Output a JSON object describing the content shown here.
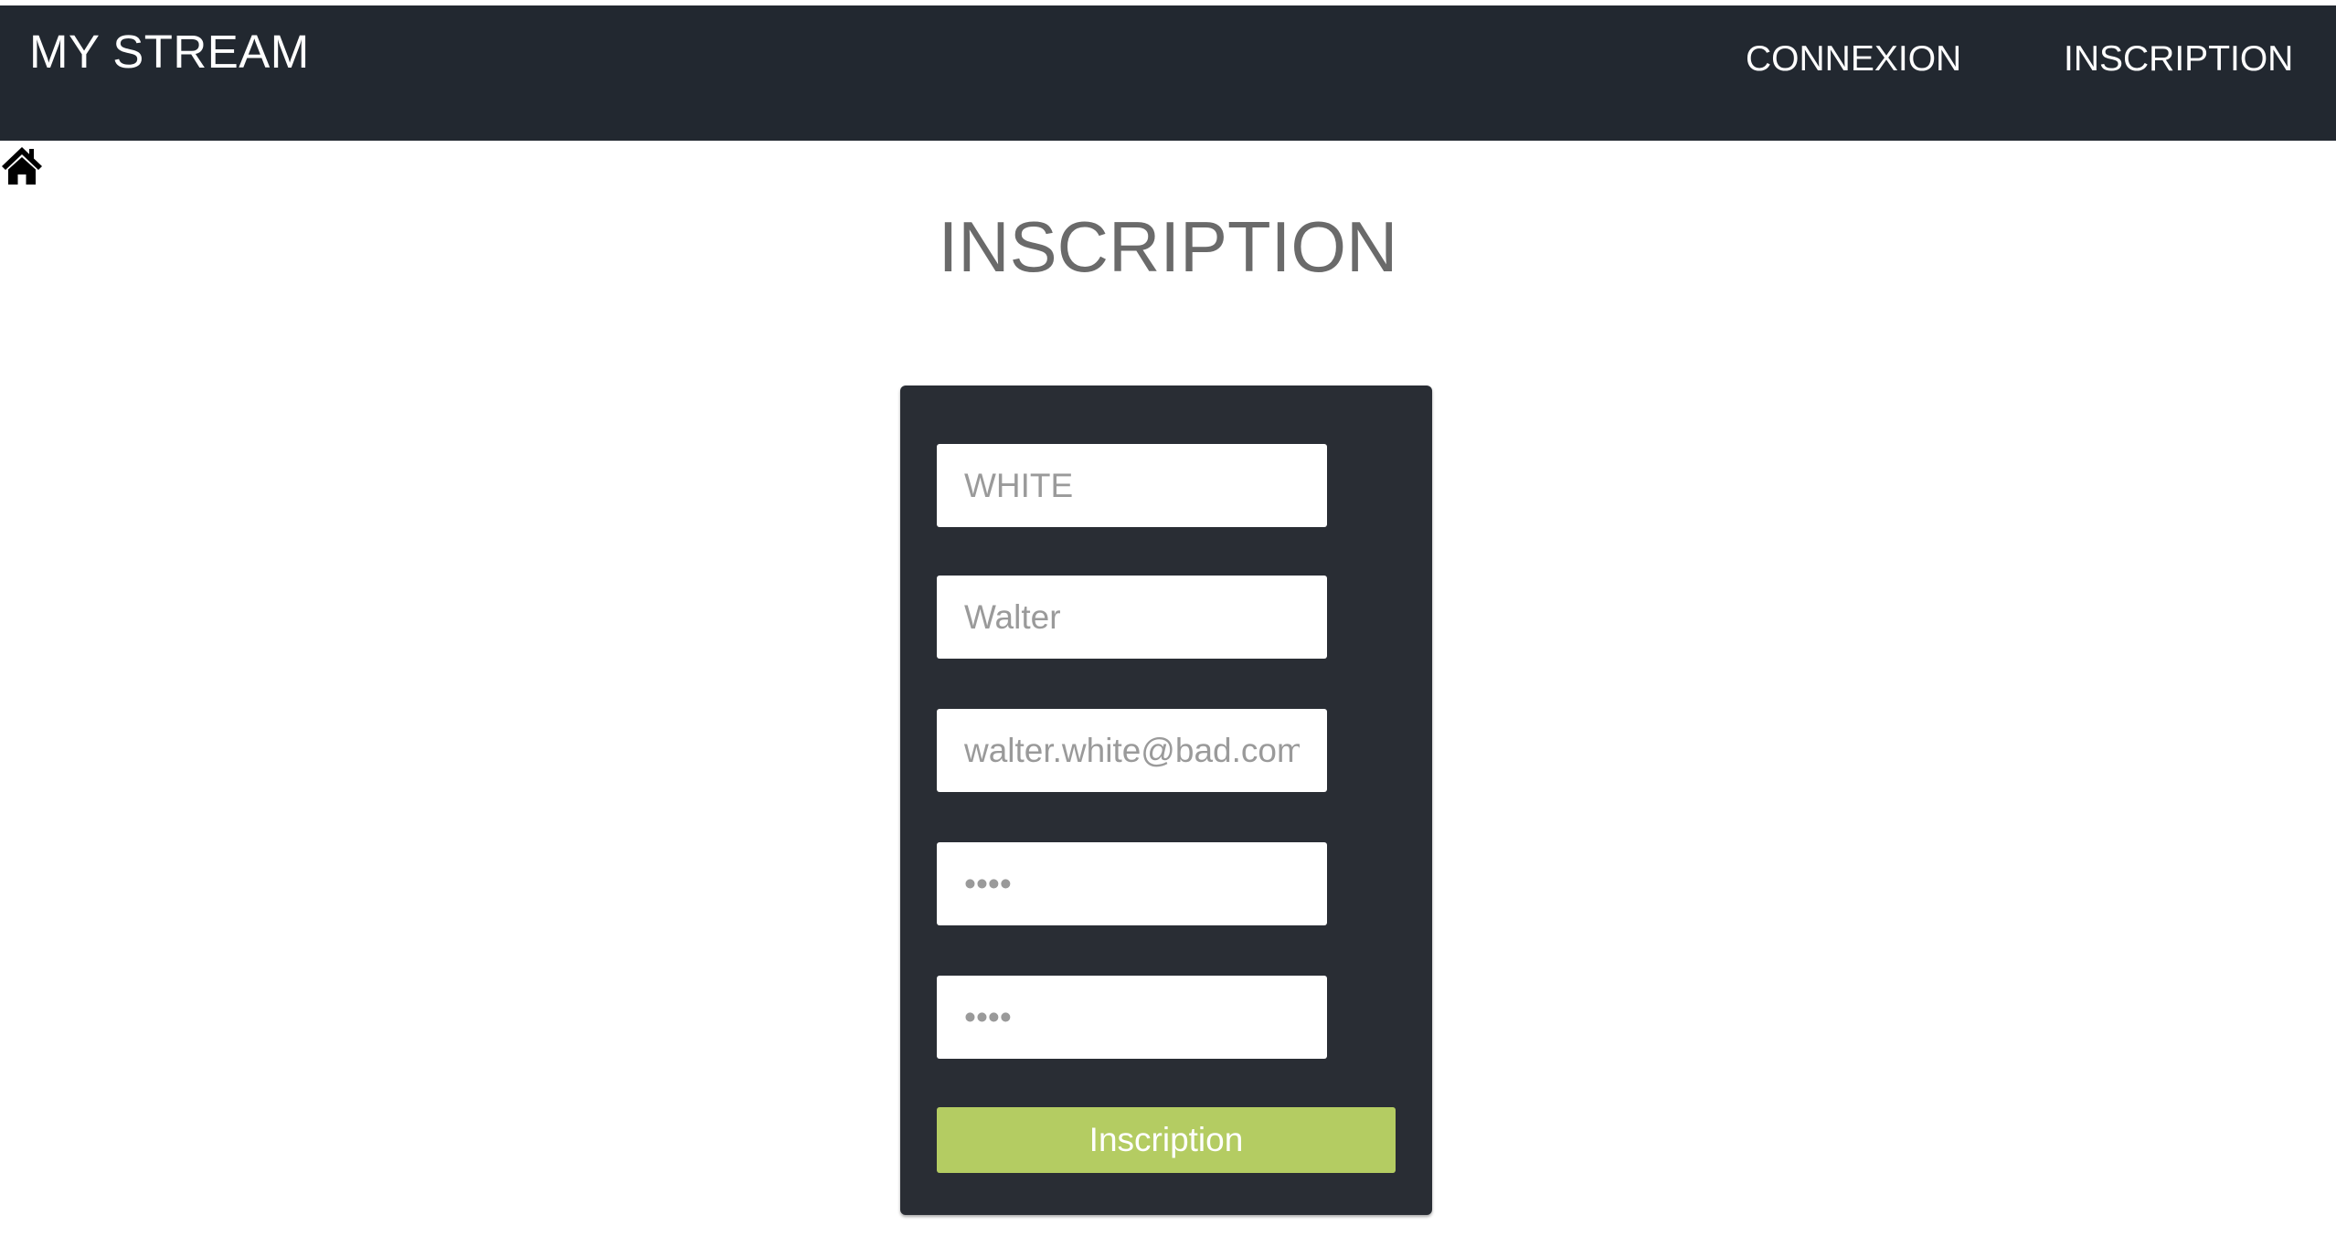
{
  "header": {
    "brand": "MY STREAM",
    "nav": {
      "login": "CONNEXION",
      "signup": "INSCRIPTION"
    }
  },
  "icons": {
    "home": "home-icon"
  },
  "page": {
    "title": "INSCRIPTION"
  },
  "form": {
    "last_name": {
      "placeholder": "WHITE",
      "value": ""
    },
    "first_name": {
      "placeholder": "Walter",
      "value": ""
    },
    "email": {
      "placeholder": "walter.white@bad.com",
      "value": ""
    },
    "password": {
      "placeholder": "••••",
      "value": ""
    },
    "password_confirm": {
      "placeholder": "••••",
      "value": ""
    },
    "submit_label": "Inscription"
  },
  "colors": {
    "header_bg": "#222830",
    "card_bg": "#292d34",
    "accent": "#b4cc62",
    "title": "#6a6a6a"
  }
}
